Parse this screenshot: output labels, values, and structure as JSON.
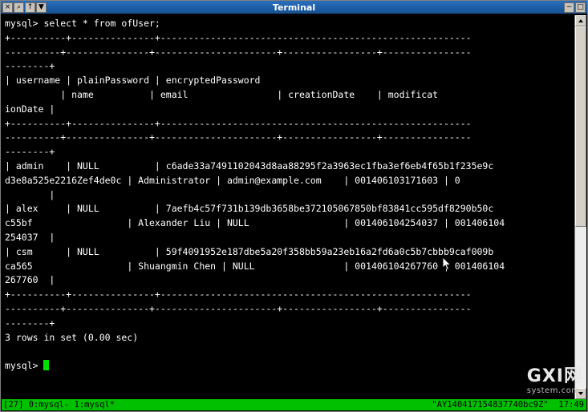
{
  "window": {
    "title": "Terminal",
    "left_buttons": [
      "×",
      "⌕",
      "↑",
      "▼"
    ],
    "right_buttons": [
      "−",
      "□"
    ]
  },
  "terminal": {
    "lines": [
      "mysql> select * from ofUser;",
      "+----------+---------------+--------------------------------------------------------",
      "----------+---------------+----------------------+-----------------+----------------",
      "--------+",
      "| username | plainPassword | encryptedPassword                                      ",
      "          | name          | email                | creationDate    | modificat",
      "ionDate |",
      "+----------+---------------+--------------------------------------------------------",
      "----------+---------------+----------------------+-----------------+----------------",
      "--------+",
      "| admin    | NULL          | c6ade33a7491102043d8aa88295f2a3963ec1fba3ef6eb4f65b1f235e9c",
      "d3e8a525e2216Zef4de0c | Administrator | admin@example.com    | 001406103171603 | 0",
      "        |",
      "| alex     | NULL          | 7aefb4c57f731b139db3658be372105067850bf83841cc595df8290b50c",
      "c55bf                 | Alexander Liu | NULL                 | 001406104254037 | 001406104",
      "254037  |",
      "| csm      | NULL          | 59f4091952e187dbe5a20f358bb59a23eb16a2fd6a0c5b7cbbb9caf009b",
      "ca565                 | Shuangmin Chen | NULL                | 001406104267760 | 001406104",
      "267760  |",
      "+----------+---------------+--------------------------------------------------------",
      "----------+---------------+----------------------+-----------------+----------------",
      "--------+",
      "3 rows in set (0.00 sec)",
      "",
      "mysql> "
    ],
    "prompt": "mysql> ",
    "cursor": "block"
  },
  "status_bar": {
    "left": "[27] 0:mysql- 1:mysql*",
    "right": "\"AY140417154837740bc9Z\"  17:49"
  },
  "watermark": {
    "main": "GXI网",
    "sub": "system.com"
  },
  "colors": {
    "terminal_bg": "#000000",
    "terminal_fg": "#ffffff",
    "status_bg": "#00c000",
    "status_fg": "#000000",
    "titlebar_bg": "#1f5fa8",
    "cursor": "#00e000"
  }
}
